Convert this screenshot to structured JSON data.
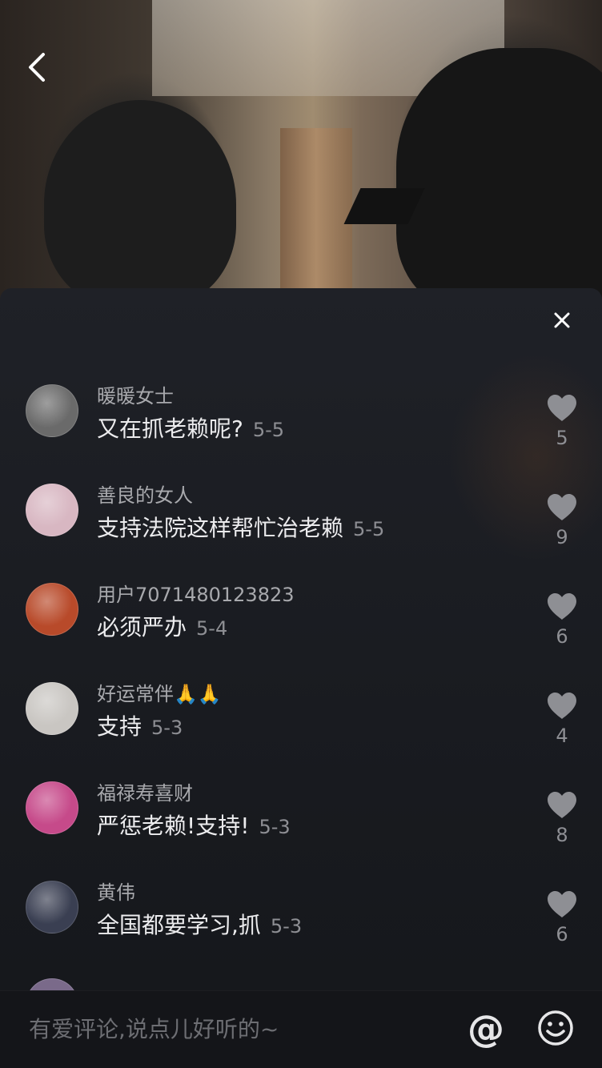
{
  "header": {
    "back_icon": "chevron-left-icon"
  },
  "panel": {
    "close_icon": "close-icon",
    "comments": [
      {
        "username": "暖暖女士",
        "text": "又在抓老赖呢?",
        "date": "5-5",
        "likes": "5",
        "avatar_color": "#6a6a6a"
      },
      {
        "username": "善良的女人",
        "text": "支持法院这样帮忙治老赖",
        "date": "5-5",
        "likes": "9",
        "avatar_color": "#d8b7c2"
      },
      {
        "username": "用户7071480123823",
        "text": "必须严办",
        "date": "5-4",
        "likes": "6",
        "avatar_color": "#b84a2a"
      },
      {
        "username": "好运常伴🙏🙏",
        "text": "支持",
        "date": "5-3",
        "likes": "4",
        "avatar_color": "#c9c6c2"
      },
      {
        "username": "福禄寿喜财",
        "text": "严惩老赖!支持!",
        "date": "5-3",
        "likes": "8",
        "avatar_color": "#c64a8a"
      },
      {
        "username": "黄伟",
        "text": "全国都要学习,抓",
        "date": "5-3",
        "likes": "6",
        "avatar_color": "#3a3f52"
      }
    ]
  },
  "input_bar": {
    "placeholder": "有爱评论,说点儿好听的~",
    "at_label": "@",
    "emoji_icon": "smiley-icon"
  },
  "colors": {
    "panel_bg": "#1d1f24",
    "username": "#a8a9ad",
    "comment_text": "#ececee",
    "meta_text": "#8e8f94",
    "heart": "#8e8f94"
  }
}
